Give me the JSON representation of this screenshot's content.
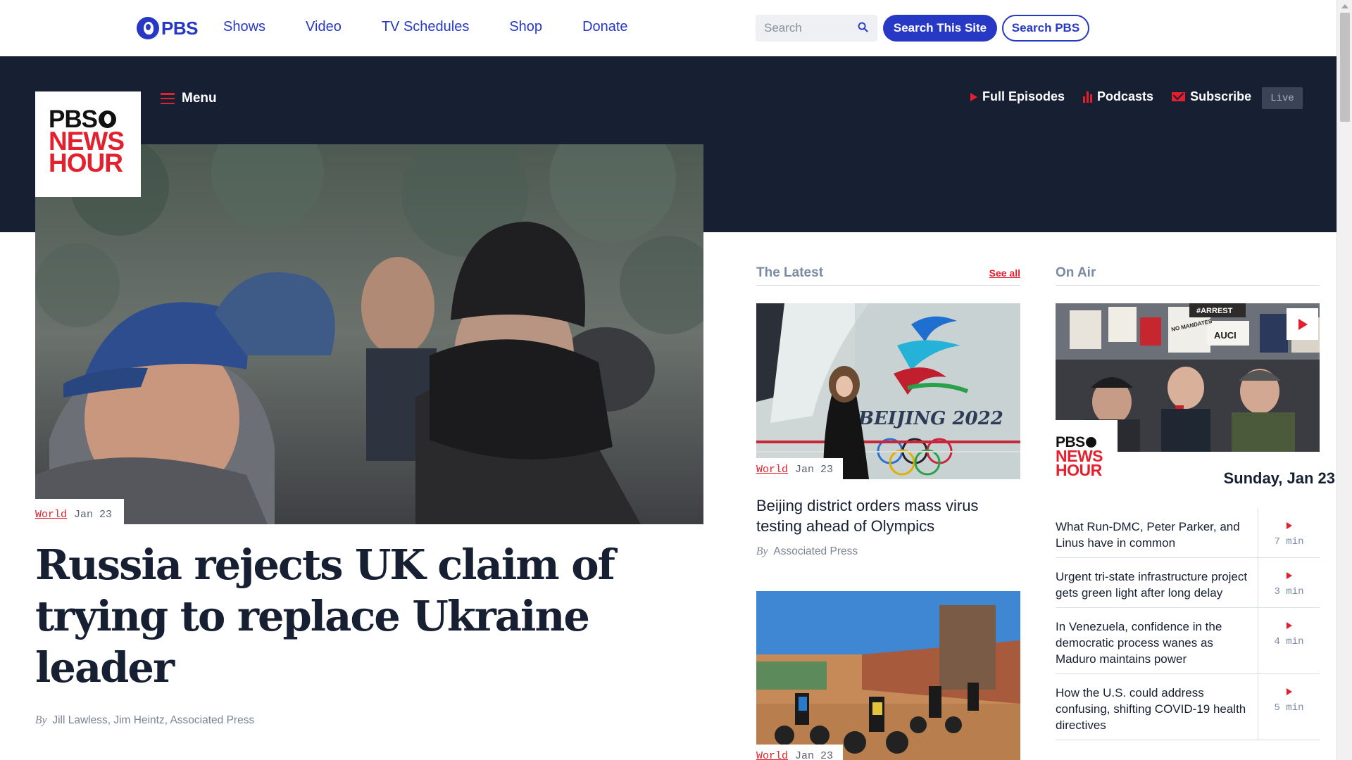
{
  "pbs_bar": {
    "logo_text": "PBS",
    "nav": [
      "Shows",
      "Video",
      "TV Schedules",
      "Shop",
      "Donate"
    ],
    "search_placeholder": "Search",
    "search_site_label": "Search This Site",
    "search_pbs_label": "Search PBS"
  },
  "newshour": {
    "logo_line1": "PBS",
    "logo_line2": "NEWS",
    "logo_line3": "HOUR",
    "menu_label": "Menu",
    "links": {
      "full_episodes": "Full Episodes",
      "podcasts": "Podcasts",
      "subscribe": "Subscribe"
    },
    "live_label": "Live"
  },
  "lead": {
    "category": "World",
    "date": "Jan 23",
    "headline": "Russia rejects UK claim of trying to replace Ukraine leader",
    "by": "By",
    "authors": "Jill Lawless, Jim Heintz, Associated Press"
  },
  "latest": {
    "heading": "The Latest",
    "see_all": "See all",
    "stories": [
      {
        "category": "World",
        "date": "Jan 23",
        "title": "Beijing district orders mass virus testing ahead of Olympics",
        "by": "By",
        "author": "Associated Press",
        "image_sign_text": "BEIJING 2022"
      },
      {
        "category": "World",
        "date": "Jan 23"
      }
    ]
  },
  "on_air": {
    "heading": "On Air",
    "date": "Sunday, Jan 23",
    "image_sign_text": [
      "#ARREST",
      "NO MANDATES",
      "AUCI"
    ],
    "episodes": [
      {
        "title": "What Run-DMC, Peter Parker, and Linus have in common",
        "duration": "7 min"
      },
      {
        "title": "Urgent tri-state infrastructure project gets green light after long delay",
        "duration": "3 min"
      },
      {
        "title": "In Venezuela, confidence in the democratic process wanes as Maduro maintains power",
        "duration": "4 min"
      },
      {
        "title": "How the U.S. could address confusing, shifting COVID-19 health directives",
        "duration": "5 min"
      }
    ]
  },
  "colors": {
    "pbs_blue": "#2638c4",
    "newshour_red": "#e3202e",
    "header_navy": "#172033",
    "muted": "#7b8aa3"
  },
  "icons": [
    "pbs-head-icon",
    "search-icon",
    "menu-icon",
    "play-icon",
    "podcast-bars-icon",
    "mail-icon"
  ]
}
